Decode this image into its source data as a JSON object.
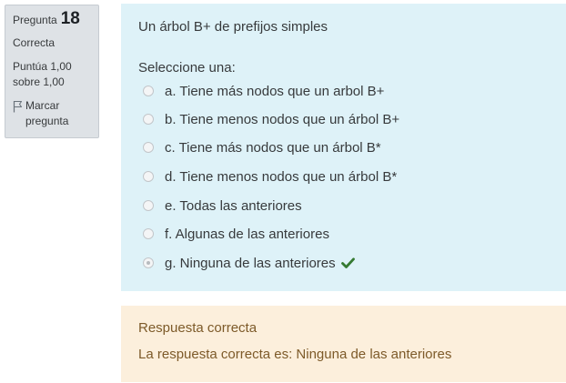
{
  "info": {
    "question_label": "Pregunta",
    "question_number": "18",
    "state": "Correcta",
    "grade_line1": "Puntúa 1,00",
    "grade_line2": "sobre 1,00",
    "flag_line1": "Marcar",
    "flag_line2": "pregunta"
  },
  "question": {
    "text": "Un árbol B+ de prefijos simples",
    "prompt": "Seleccione una:",
    "answers": [
      {
        "label": "a. Tiene más nodos que un arbol B+",
        "selected": false
      },
      {
        "label": "b. Tiene menos nodos que un árbol B+",
        "selected": false
      },
      {
        "label": "c. Tiene más nodos que un árbol B*",
        "selected": false
      },
      {
        "label": "d. Tiene menos nodos que un árbol B*",
        "selected": false
      },
      {
        "label": "e. Todas las anteriores",
        "selected": false
      },
      {
        "label": "f. Algunas de las anteriores",
        "selected": false
      },
      {
        "label": "g. Ninguna de las anteriores",
        "selected": true,
        "correct": true
      }
    ]
  },
  "feedback": {
    "title": "Respuesta correcta",
    "right_answer": "La respuesta correcta es: Ninguna de las anteriores"
  },
  "colors": {
    "info_bg": "#dee2e6",
    "formulation_bg": "#def2f8",
    "feedback_bg": "#fcefdc",
    "feedback_text": "#7d5a29",
    "correct_check": "#357a32"
  },
  "icons": {
    "flag": "flag-icon",
    "correct": "check-icon",
    "radio": "radio-icon"
  }
}
